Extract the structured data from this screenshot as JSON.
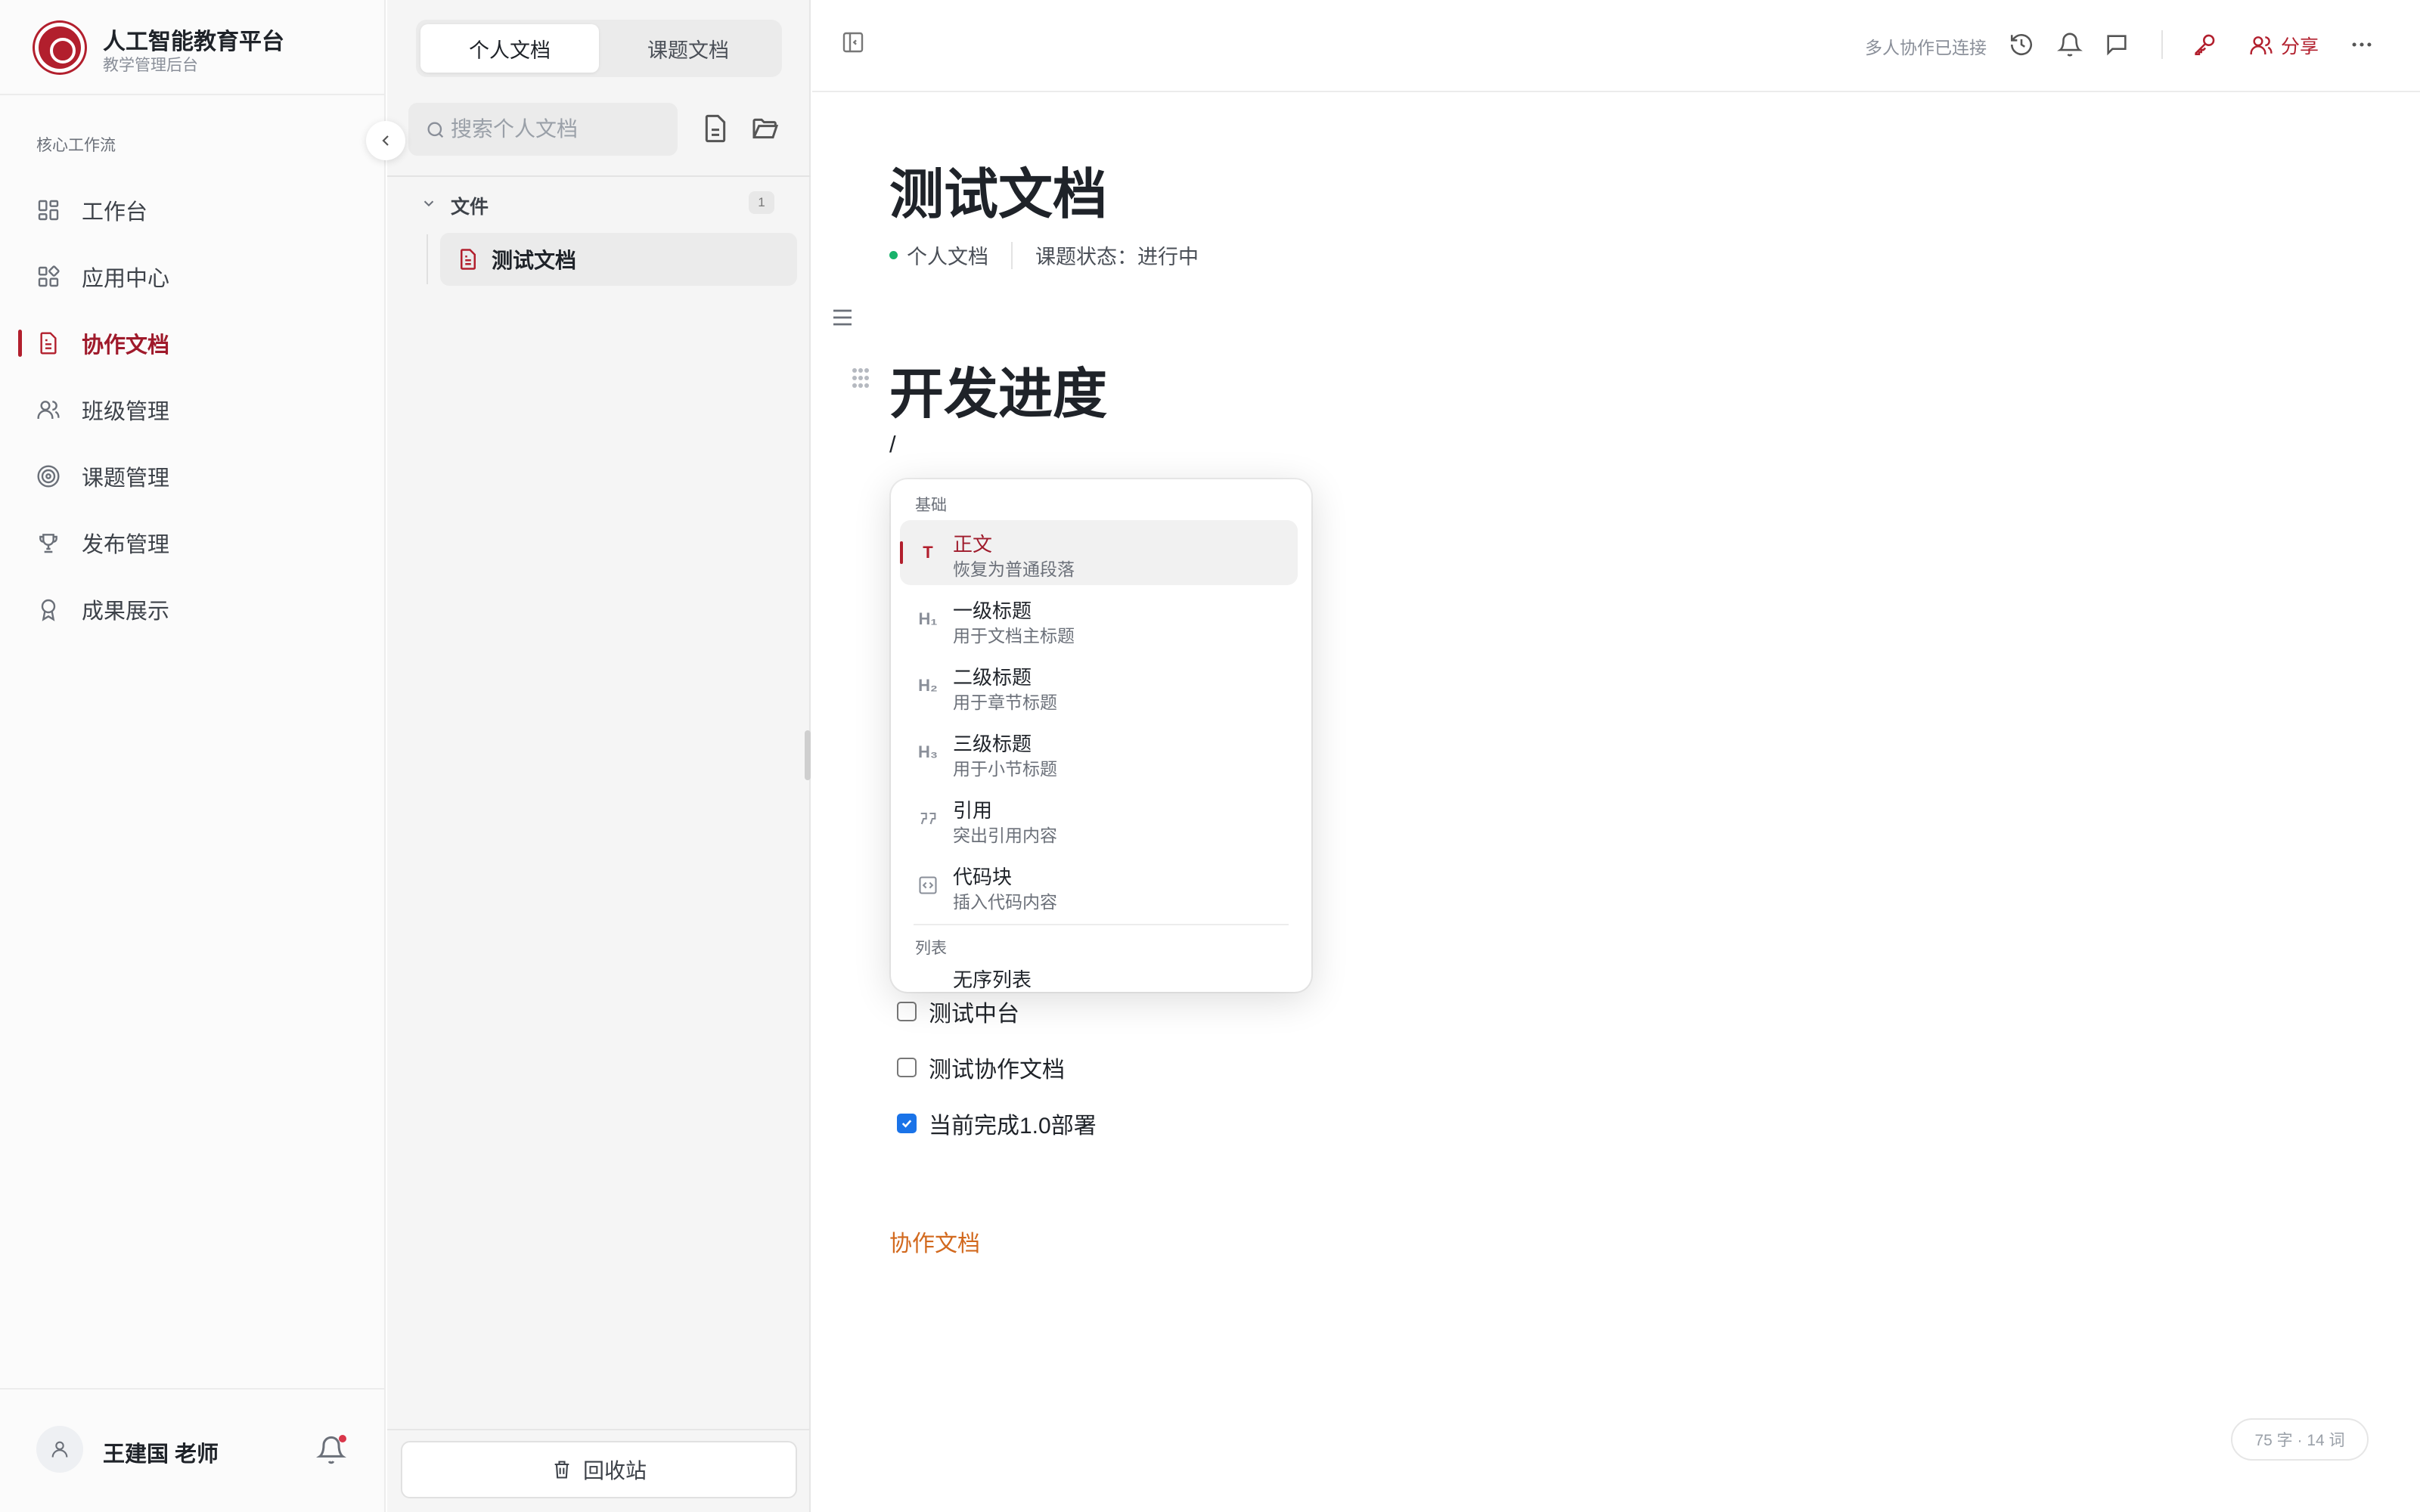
{
  "brand": {
    "title": "人工智能教育平台",
    "subtitle": "教学管理后台"
  },
  "nav": {
    "section": "核心工作流",
    "items": [
      {
        "label": "工作台",
        "icon": "dashboard-icon"
      },
      {
        "label": "应用中心",
        "icon": "apps-icon"
      },
      {
        "label": "协作文档",
        "icon": "document-icon",
        "active": true
      },
      {
        "label": "班级管理",
        "icon": "users-icon"
      },
      {
        "label": "课题管理",
        "icon": "target-icon"
      },
      {
        "label": "发布管理",
        "icon": "trophy-icon"
      },
      {
        "label": "成果展示",
        "icon": "award-icon"
      }
    ]
  },
  "user": {
    "name": "王建国 老师"
  },
  "docpanel": {
    "tabs": [
      "个人文档",
      "课题文档"
    ],
    "active_tab": "个人文档",
    "search_placeholder": "搜索个人文档",
    "folder": {
      "label": "文件",
      "count": "1"
    },
    "documents": [
      "测试文档"
    ],
    "trash_label": "回收站"
  },
  "toolbar": {
    "collab_status": "多人协作已连接",
    "share_label": "分享"
  },
  "document": {
    "title": "测试文档",
    "meta_space": "个人文档",
    "meta_status": "课题状态：进行中",
    "heading": "开发进度",
    "slash": "/",
    "tasks": [
      {
        "label": "测试中台",
        "checked": false
      },
      {
        "label": "测试协作文档",
        "checked": false
      },
      {
        "label": "当前完成1.0部署",
        "checked": true
      }
    ],
    "link": "协作文档",
    "word_count": "75 字 · 14 词"
  },
  "slash_menu": {
    "group_basic": "基础",
    "group_list": "列表",
    "items": [
      {
        "title": "正文",
        "desc": "恢复为普通段落",
        "icon": "T",
        "active": true
      },
      {
        "title": "一级标题",
        "desc": "用于文档主标题",
        "icon": "H1"
      },
      {
        "title": "二级标题",
        "desc": "用于章节标题",
        "icon": "H2"
      },
      {
        "title": "三级标题",
        "desc": "用于小节标题",
        "icon": "H3"
      },
      {
        "title": "引用",
        "desc": "突出引用内容",
        "icon": "quote"
      },
      {
        "title": "代码块",
        "desc": "插入代码内容",
        "icon": "code"
      }
    ],
    "partial_item": "无序列表"
  },
  "colors": {
    "accent": "#b21f2d",
    "link": "#d2691e",
    "status_dot": "#17b26a",
    "checkbox": "#1a73e8"
  }
}
